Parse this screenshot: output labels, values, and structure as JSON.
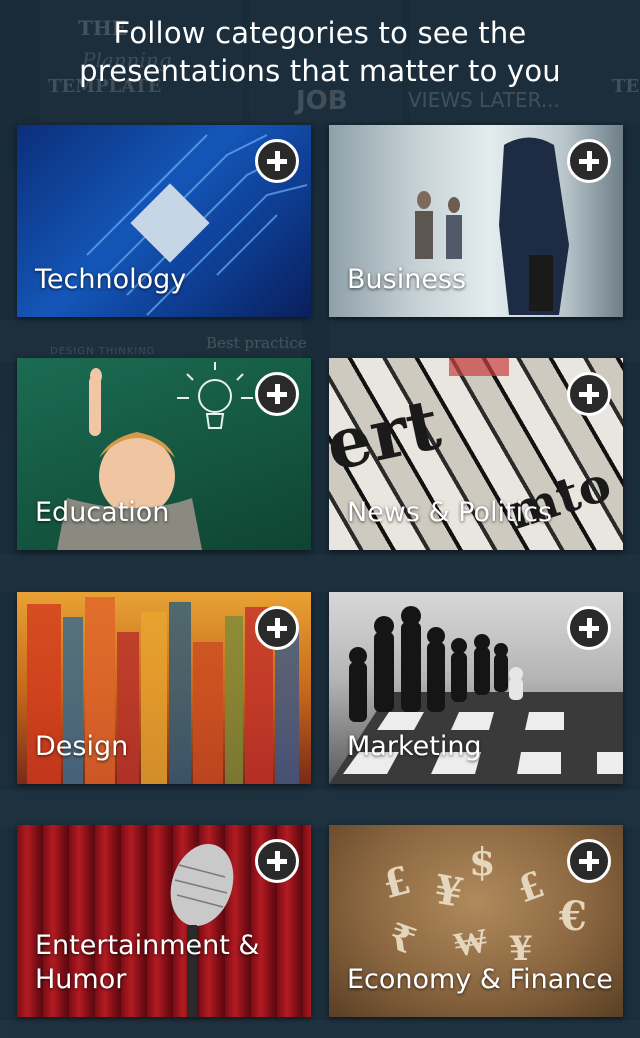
{
  "header": {
    "line1": "Follow categories to see the",
    "line2": "presentations that matter to you"
  },
  "background": {
    "snippets": [
      "THE",
      "Planning",
      "TEMPLATE",
      "JOB",
      "VIEWS LATER...",
      "Best practice",
      "DESIGN THINKING",
      "TE"
    ]
  },
  "categories": [
    {
      "label": "Technology",
      "follow_icon": "plus-icon"
    },
    {
      "label": "Business",
      "follow_icon": "plus-icon"
    },
    {
      "label": "Education",
      "follow_icon": "plus-icon"
    },
    {
      "label": "News & Politics",
      "follow_icon": "plus-icon"
    },
    {
      "label": "Design",
      "follow_icon": "plus-icon"
    },
    {
      "label": "Marketing",
      "follow_icon": "plus-icon"
    },
    {
      "label": "Entertainment & Humor",
      "follow_icon": "plus-icon"
    },
    {
      "label": "Economy & Finance",
      "follow_icon": "plus-icon"
    }
  ],
  "colors": {
    "background": "#1f3442",
    "text": "#ffffff"
  }
}
